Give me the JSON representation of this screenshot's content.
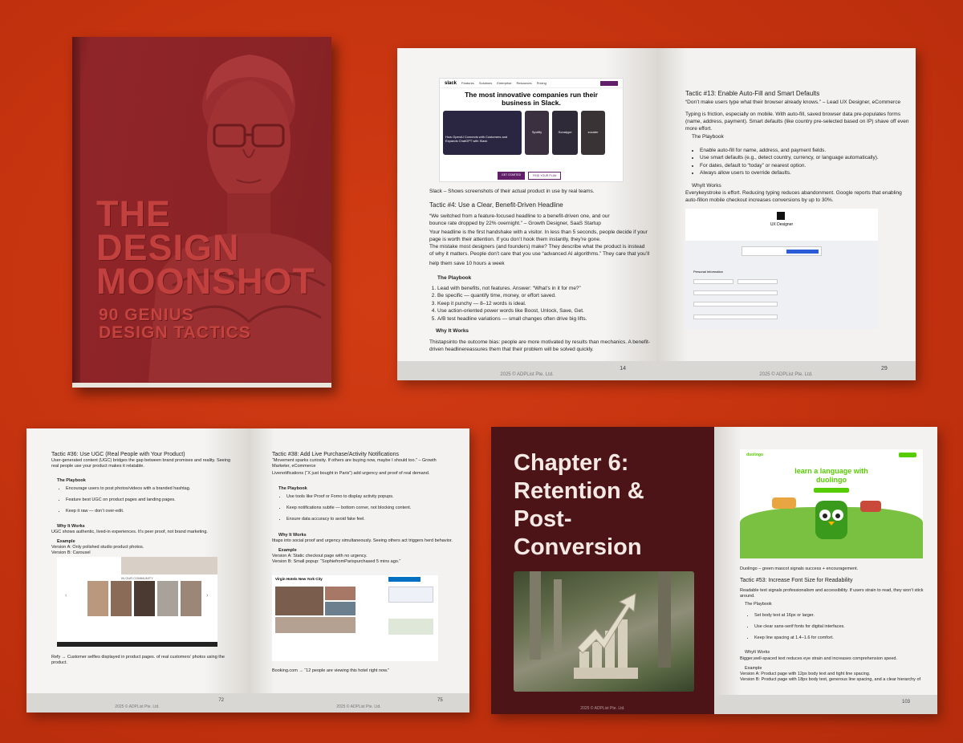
{
  "cover": {
    "title_lines": [
      "THE",
      "DESIGN",
      "MOONSHOT"
    ],
    "subtitle_lines": [
      "90 GENIUS",
      "DESIGN TACTICS"
    ]
  },
  "spread1": {
    "slack_nav": [
      "Features",
      "Solutions",
      "Enterprise",
      "Resources",
      "Pricing"
    ],
    "slack_headline": "The most innovative companies run their business in Slack.",
    "slack_card": "How OpenAI Connects with Customers and Expands ChatGPT with Slack",
    "slack_logos": [
      "Spotify",
      "Sonatype",
      "zocater"
    ],
    "slack_buttons": [
      "GET STARTED",
      "FIND YOUR PLAN"
    ],
    "caption": "Slack – Shows screenshots of their actual product in use by real teams.",
    "tactic4_title": "Tactic #4: Use a Clear, Benefit-Driven Headline",
    "tactic4_quote": "“We switched from a feature-focused headline to a benefit-driven one, and our bounce rate dropped by 22% overnight.” – Growth Designer, SaaS Startup",
    "tactic4_body1": "Your headline is the first handshake with a visitor. In less than 5 seconds, people decide if your page is worth their attention. If you don’t hook them instantly, they’re gone.",
    "tactic4_body2": "The mistake most designers (and founders) make? They describe what the product is instead of why it matters. People don’t care that you use “advanced AI algorithms.” They care that you’ll",
    "tactic4_body3": "help them save 10 hours a week",
    "playbook": "The Playbook",
    "tactic4_list": [
      "Lead with benefits, not features. Answer: “What’s in it for me?”",
      "Be specific — quantify time, money, or effort saved.",
      "Keep it punchy — 8–12 words is ideal.",
      "Use action-oriented power words like Boost, Unlock, Save, Get.",
      "A/B test headline variations — small changes often drive big lifts."
    ],
    "why": "Why It Works",
    "tactic4_why": "Thistapsinto the outcome bias: people are more motivated by results than mechanics. A benefit-driven headlinereassures them that their problem will be solved quickly.",
    "left_num": "14",
    "tactic13_title": "Tactic #13: Enable Auto-Fill and Smart Defaults",
    "tactic13_quote": "“Don’t make users type what their browser already knows.” – Lead UX Designer, eCommerce",
    "tactic13_body": "Typing is friction, especially on mobile. With auto-fill, saved browser data pre-populates forms (name, address, payment). Smart defaults (like country pre-selected based on IP) shave off even more effort.",
    "tactic13_list": [
      "Enable auto-fill for name, address, and payment fields.",
      "Use smart defaults (e.g., detect country, currency, or language automatically).",
      "For dates, default to “today” or nearest option.",
      "Always allow users to override defaults."
    ],
    "whyit": "WhyIt Works",
    "tactic13_why": "Everykeystroke is effort. Reducing typing reduces abandonment. Google reports that enabling auto-fillon mobile checkout increases conversions by up to 30%.",
    "form_title": "UX Designer",
    "form_section": "Personal Information",
    "right_num": "29",
    "copyright": "2025 © ADPList Pte. Ltd."
  },
  "spread2": {
    "tactic36_title": "Tactic #36: Use UGC (Real People with Your Product)",
    "tactic36_body": "User-generated content (UGC) bridges the gap between brand promises and reality. Seeing real people use your product makes it relatable.",
    "playbook": "The Playbook",
    "tactic36_list": [
      "Encourage users to post photos/videos with a branded hashtag.",
      "Feature best UGC on product pages and landing pages.",
      "Keep it raw — don’t over-edit."
    ],
    "why": "Why It Works",
    "tactic36_why": "UGC shows authentic, lived-in experiences. It’s peer proof, not brand marketing.",
    "example": "Example",
    "tactic36_vA": "Version A: Only polished studio product photos.",
    "tactic36_vB": "Version B: Carousel",
    "ugc_label": "IN OUR COMMUNITY",
    "caption": "Refy → Customer selfies displayed in product pages. of real customers’ photos using the product.",
    "left_num": "72",
    "tactic38_title": "Tactic #38: Add Live Purchase/Activity Notifications",
    "tactic38_quote": "“Movement sparks curiosity. If others are buying now, maybe I should too.” – Growth Marketer, eCommerce",
    "tactic38_body": "Livenotifications (“X just bought in Paris”) add urgency and proof of real demand.",
    "tactic38_list": [
      "Use tools like Proof or Fomo to display activity popups.",
      "Keep notifications subtle — bottom corner, not blocking content.",
      "Ensure data accuracy to avoid fake feel."
    ],
    "tactic38_why": "Ittaps into social proof and urgency simultaneously. Seeing others act triggers herd behavior.",
    "tactic38_vA": "Version A: Static checkout page with no urgency.",
    "tactic38_vB": "Version B: Small popup: “SophiefromParispurchased 5 mins ago.”",
    "hotel_name": "Virgin Hotels New York City",
    "booking_caption": "Booking.com → “12 people are viewing this hotel right now.”",
    "right_num": "75",
    "copyright": "2025 © ADPList Pte. Ltd."
  },
  "spread3": {
    "chapter_lines": [
      "Chapter 6:",
      "Retention &",
      "Post-",
      "Conversion"
    ],
    "copyright": "2025 © ADPList Pte. Ltd.",
    "duo_brand": "duolingo",
    "duo_headline": "learn a language with duolingo",
    "duo_caption": "Duolingo – green mascot signals success + encouragement.",
    "tactic53_title": "Tactic #53: Increase Font Size for Readability",
    "tactic53_body": "Readable text signals professionalism and accessibility. If users strain to read, they won’t stick around.",
    "playbook": "The Playbook",
    "tactic53_list": [
      "Set body text at 16px or larger.",
      "Use clear sans-serif fonts for digital interfaces.",
      "Keep line spacing at 1.4–1.6 for comfort."
    ],
    "whyit": "WhyIt Works",
    "tactic53_why": "Bigger,well-spaced text reduces eye strain and increases comprehension speed.",
    "example": "Example",
    "tactic53_vA": "Version A: Product page with 12px body text and tight line spacing.",
    "tactic53_vB": "Version B: Product page with 18px body text, generous line spacing, and a clear hierarchy of",
    "right_num": "103"
  },
  "colors": {
    "background": "#c7330f",
    "cover": "#8c2427",
    "chapter_page": "#4d1418",
    "duo_green": "#58cc02"
  }
}
